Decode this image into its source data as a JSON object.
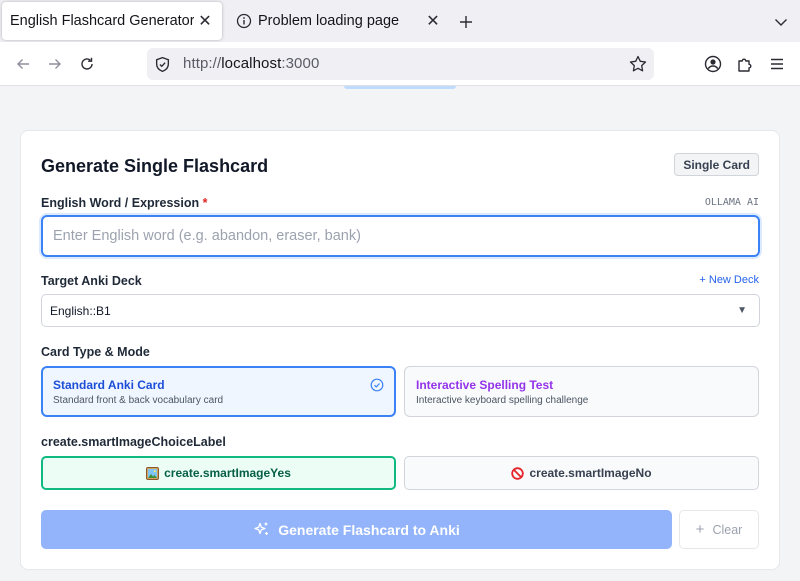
{
  "browser": {
    "tabs": [
      {
        "title": "English Flashcard Generator",
        "active": true
      },
      {
        "title": "Problem loading page",
        "active": false
      }
    ],
    "url_scheme": "http://",
    "url_host": "localhost",
    "url_port": ":3000",
    "icons": {
      "back": "arrow-left-icon",
      "forward": "arrow-right-icon",
      "reload": "reload-icon",
      "shield": "shield-icon",
      "bookmark": "star-icon",
      "account": "account-icon",
      "extensions": "puzzle-icon",
      "menu": "hamburger-menu-icon"
    }
  },
  "form": {
    "title": "Generate Single Flashcard",
    "mode_badge": "Single Card",
    "word_label": "English Word / Expression",
    "required_mark": "*",
    "ai_tag": "OLLAMA AI",
    "word_value": "",
    "word_placeholder": "Enter English word (e.g. abandon, eraser, bank)",
    "deck_label": "Target Anki Deck",
    "new_deck_link": "+ New Deck",
    "deck_selected": "English::B1",
    "card_type_label": "Card Type & Mode",
    "card_types": [
      {
        "title": "Standard Anki Card",
        "description": "Standard front & back vocabulary card",
        "selected": true
      },
      {
        "title": "Interactive Spelling Test",
        "description": "Interactive keyboard spelling challenge",
        "selected": false
      }
    ],
    "image_choice_label": "create.smartImageChoiceLabel",
    "image_choices": [
      {
        "emoji": "🖼️",
        "label": "create.smartImageYes",
        "selected": true
      },
      {
        "emoji": "🚫",
        "label": "create.smartImageNo",
        "selected": false
      }
    ],
    "generate_button": "Generate Flashcard to Anki",
    "clear_button": "Clear"
  },
  "colors": {
    "accent_blue": "#3b82f6",
    "generate_disabled": "#93b4fb",
    "spelling_purple": "#9333ea",
    "smart_image_green": "#10b981",
    "required_red": "#dc2626"
  }
}
